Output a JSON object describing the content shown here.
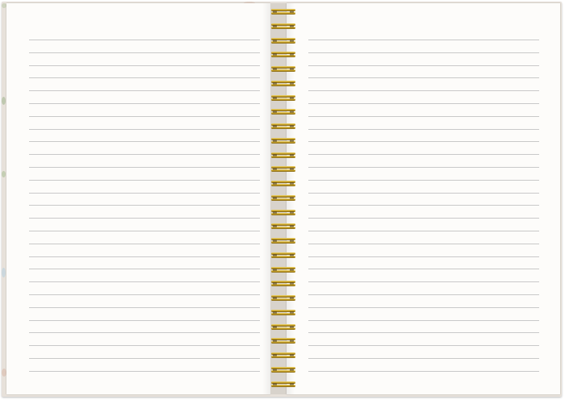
{
  "notebook": {
    "binding": "spiral",
    "ring_count": 27,
    "ring_color": "#c9a227",
    "cover_color": "#e7e1da",
    "page_color": "#fdfcfa",
    "rule_color": "#c9c9c9"
  },
  "left_page": {
    "ruled_line_count": 27
  },
  "right_page": {
    "ruled_line_count": 27
  }
}
